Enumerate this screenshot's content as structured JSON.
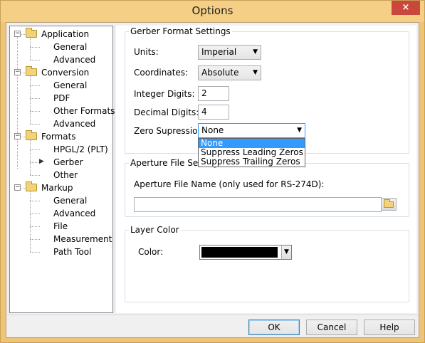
{
  "window": {
    "title": "Options",
    "close_glyph": "×"
  },
  "tree": {
    "sections": [
      {
        "label": "Application",
        "items": [
          "General",
          "Advanced"
        ]
      },
      {
        "label": "Conversion",
        "items": [
          "General",
          "PDF",
          "Other Formats",
          "Advanced"
        ]
      },
      {
        "label": "Formats",
        "items": [
          "HPGL/2 (PLT)",
          "Gerber",
          "Other"
        ]
      },
      {
        "label": "Markup",
        "items": [
          "General",
          "Advanced",
          "File",
          "Measurement",
          "Path Tool"
        ]
      }
    ],
    "selected": "Gerber",
    "expander_glyph": "−"
  },
  "gerber": {
    "title": "Gerber Format Settings",
    "units_label": "Units:",
    "units_value": "Imperial",
    "coordinates_label": "Coordinates:",
    "coordinates_value": "Absolute",
    "integer_label": "Integer Digits:",
    "integer_value": "2",
    "decimal_label": "Decimal Digits:",
    "decimal_value": "4",
    "zero_label": "Zero Supression:",
    "zero_value": "None",
    "zero_options": [
      "None",
      "Suppress Leading Zeros",
      "Suppress Trailing Zeros"
    ]
  },
  "aperture": {
    "title": "Aperture File Settings",
    "file_label": "Aperture File Name (only used for RS-274D):",
    "file_value": ""
  },
  "layer": {
    "title": "Layer Color",
    "color_label": "Color:",
    "color_value": "#000000"
  },
  "buttons": {
    "ok": "OK",
    "cancel": "Cancel",
    "help": "Help"
  },
  "icons": {
    "caret": "▼",
    "arrow": "▶",
    "folder": "folder-icon"
  }
}
